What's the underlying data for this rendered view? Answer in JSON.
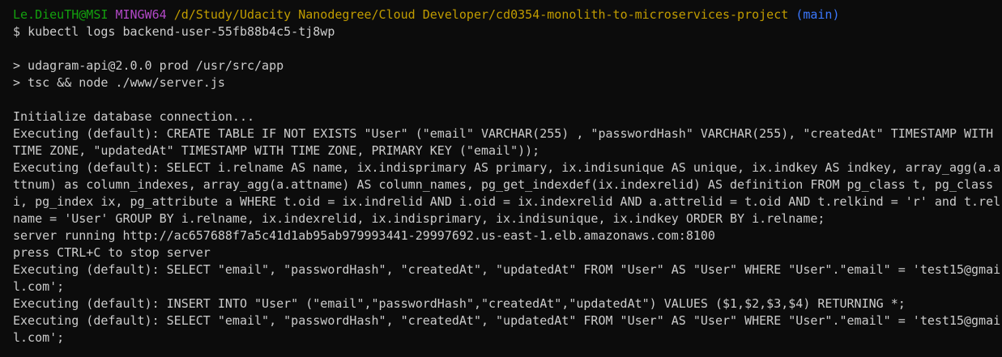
{
  "prompt": {
    "user_host": "Le.DieuTH@MSI",
    "system": "MINGW64",
    "path": "/d/Study/Udacity Nanodegree/Cloud Developer/cd0354-monolith-to-microservices-project",
    "branch": "(main)",
    "symbol": "$",
    "command": "kubectl logs backend-user-55fb88b4c5-tj8wp"
  },
  "colors": {
    "background": "#0c0c0c",
    "text": "#cccccc",
    "user_host": "#13a10e",
    "system": "#b148c6",
    "path": "#c19c00",
    "branch": "#3b78ff"
  },
  "output_lines": [
    "",
    "> udagram-api@2.0.0 prod /usr/src/app",
    "> tsc && node ./www/server.js",
    "",
    "Initialize database connection...",
    "Executing (default): CREATE TABLE IF NOT EXISTS \"User\" (\"email\" VARCHAR(255) , \"passwordHash\" VARCHAR(255), \"createdAt\" TIMESTAMP WITH",
    "TIME ZONE, \"updatedAt\" TIMESTAMP WITH TIME ZONE, PRIMARY KEY (\"email\"));",
    "Executing (default): SELECT i.relname AS name, ix.indisprimary AS primary, ix.indisunique AS unique, ix.indkey AS indkey, array_agg(a.a",
    "ttnum) as column_indexes, array_agg(a.attname) AS column_names, pg_get_indexdef(ix.indexrelid) AS definition FROM pg_class t, pg_class",
    "i, pg_index ix, pg_attribute a WHERE t.oid = ix.indrelid AND i.oid = ix.indexrelid AND a.attrelid = t.oid AND t.relkind = 'r' and t.rel",
    "name = 'User' GROUP BY i.relname, ix.indexrelid, ix.indisprimary, ix.indisunique, ix.indkey ORDER BY i.relname;",
    "server running http://ac657688f7a5c41d1ab95ab979993441-29997692.us-east-1.elb.amazonaws.com:8100",
    "press CTRL+C to stop server",
    "Executing (default): SELECT \"email\", \"passwordHash\", \"createdAt\", \"updatedAt\" FROM \"User\" AS \"User\" WHERE \"User\".\"email\" = 'test15@gmai",
    "l.com';",
    "Executing (default): INSERT INTO \"User\" (\"email\",\"passwordHash\",\"createdAt\",\"updatedAt\") VALUES ($1,$2,$3,$4) RETURNING *;",
    "Executing (default): SELECT \"email\", \"passwordHash\", \"createdAt\", \"updatedAt\" FROM \"User\" AS \"User\" WHERE \"User\".\"email\" = 'test15@gmai",
    "l.com';"
  ]
}
